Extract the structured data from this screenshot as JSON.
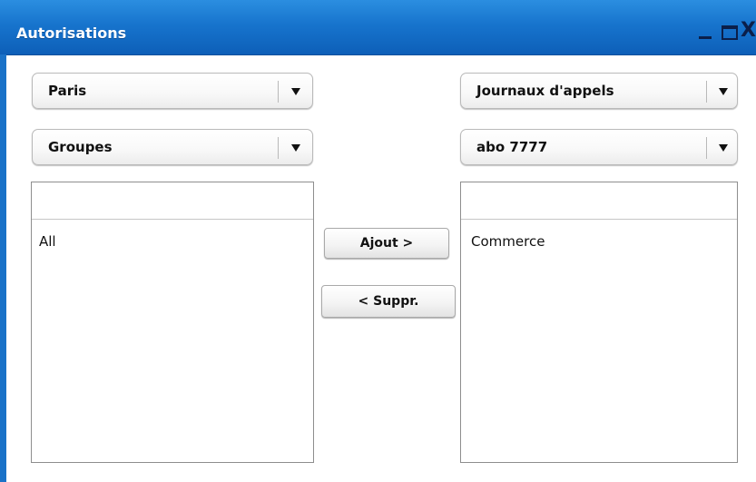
{
  "window": {
    "title": "Autorisations",
    "controls": {
      "minimize": "_",
      "maximize": "□",
      "close": "X"
    }
  },
  "left_panel": {
    "site_select": {
      "selected": "Paris"
    },
    "type_select": {
      "selected": "Groupes"
    },
    "list": {
      "header": "",
      "items": [
        "All"
      ]
    }
  },
  "right_panel": {
    "permission_select": {
      "selected": "Journaux d'appels"
    },
    "target_select": {
      "selected": "abo 7777"
    },
    "list": {
      "header": "",
      "items": [
        "Commerce"
      ]
    }
  },
  "actions": {
    "add_label": "Ajout >",
    "remove_label": "< Suppr."
  },
  "colors": {
    "titlebar": "#1774cd",
    "titlebar_text": "#ffffff"
  }
}
